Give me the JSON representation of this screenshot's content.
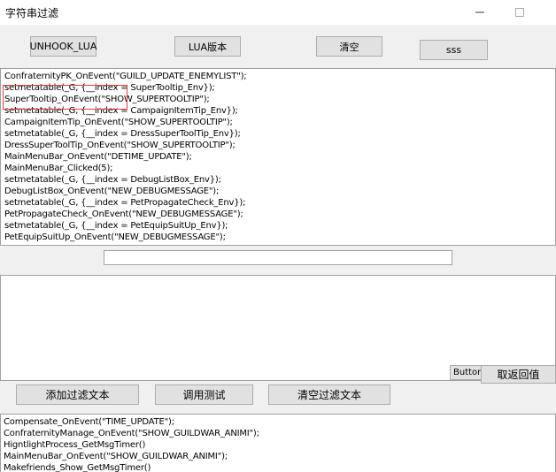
{
  "window": {
    "title": "字符串过滤"
  },
  "toolbar": {
    "unhook_label": "UNHOOK_LUA",
    "lua_version_label": "LUA版本",
    "clear_label": "清空",
    "sss_label": "sss"
  },
  "log": {
    "lines": [
      "ConfraternityPK_OnEvent(\"GUILD_UPDATE_ENEMYLIST\");",
      "setmetatable(_G, {__index = SuperTooltip_Env});",
      "SuperTooltip_OnEvent(\"SHOW_SUPERTOOLTIP\");",
      "setmetatable(_G, {__index = CampaignItemTip_Env});",
      "CampaignItemTip_OnEvent(\"SHOW_SUPERTOOLTIP\");",
      "setmetatable(_G, {__index = DressSuperToolTip_Env});",
      "DressSuperToolTip_OnEvent(\"SHOW_SUPERTOOLTIP\");",
      "MainMenuBar_OnEvent(\"DETIME_UPDATE\");",
      "MainMenuBar_Clicked(5);",
      "setmetatable(_G, {__index = DebugListBox_Env});",
      "DebugListBox_OnEvent(\"NEW_DEBUGMESSAGE\");",
      "setmetatable(_G, {__index = PetPropagateCheck_Env});",
      "PetPropagateCheck_OnEvent(\"NEW_DEBUGMESSAGE\");",
      "setmetatable(_G, {__index = PetEquipSuitUp_Env});",
      "PetEquipSuitUp_OnEvent(\"NEW_DEBUGMESSAGE\");"
    ]
  },
  "filter": {
    "value": "",
    "placeholder": ""
  },
  "middle": {
    "button_label": "Button",
    "return_label": "取返回值"
  },
  "actions": {
    "add_filter_label": "添加过滤文本",
    "debug_label": "调用测试",
    "clear_filter_label": "清空过滤文本"
  },
  "filtered_log": {
    "lines": [
      "Compensate_OnEvent(\"TIME_UPDATE\");",
      "ConfraternityManage_OnEvent(\"SHOW_GUILDWAR_ANIMI\");",
      "HigntlightProcess_GetMsgTimer()",
      "MainMenuBar_OnEvent(\"SHOW_GUILDWAR_ANIMI\");",
      "Makefriends_Show_GetMsgTimer()"
    ]
  }
}
